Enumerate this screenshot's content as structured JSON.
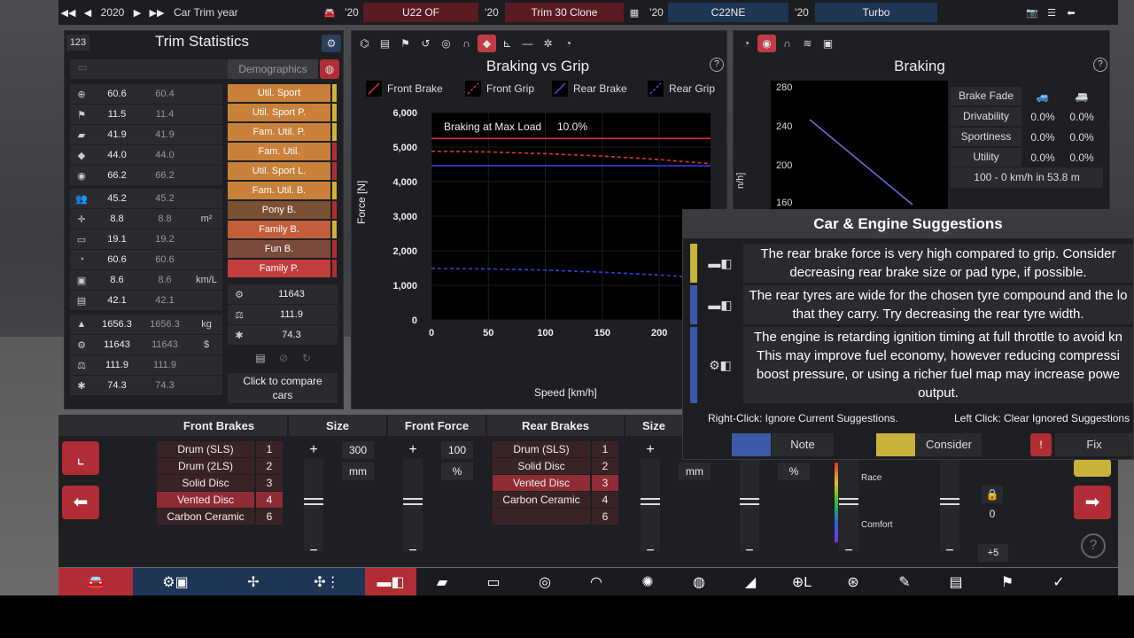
{
  "topbar": {
    "year": "2020",
    "label": "Car Trim year",
    "slots": [
      {
        "year": "'20",
        "name": "U22 OF",
        "color": "#5b1b23"
      },
      {
        "year": "'20",
        "name": "Trim 30 Clone",
        "color": "#5b1b23"
      },
      {
        "year": "'20",
        "name": "C22NE",
        "color": "#1f3555"
      },
      {
        "year": "'20",
        "name": "Turbo",
        "color": "#1f3555"
      }
    ]
  },
  "stats": {
    "badge": "123",
    "title": "Trim Statistics",
    "demographics_label": "Demographics",
    "rows": [
      {
        "icon": "steering-wheel-icon",
        "v1": "60.6",
        "v2": "60.4",
        "unit": ""
      },
      {
        "icon": "flag-icon",
        "v1": "11.5",
        "v2": "11.4",
        "unit": ""
      },
      {
        "icon": "seat-icon",
        "v1": "41.9",
        "v2": "41.9",
        "unit": ""
      },
      {
        "icon": "gem-icon",
        "v1": "44.0",
        "v2": "44.0",
        "unit": ""
      },
      {
        "icon": "ball-icon",
        "v1": "66.2",
        "v2": "66.2",
        "unit": ""
      },
      {
        "icon": "people-icon",
        "v1": "45.2",
        "v2": "45.2",
        "unit": ""
      },
      {
        "icon": "dimensions-icon",
        "v1": "8.8",
        "v2": "8.8",
        "unit": "m²"
      },
      {
        "icon": "car-icon",
        "v1": "19.1",
        "v2": "19.2",
        "unit": ""
      },
      {
        "icon": "gauge-icon",
        "v1": "60.6",
        "v2": "60.6",
        "unit": ""
      },
      {
        "icon": "fuel-icon",
        "v1": "8.6",
        "v2": "8.6",
        "unit": "km/L"
      },
      {
        "icon": "emissions-icon",
        "v1": "42.1",
        "v2": "42.1",
        "unit": ""
      },
      {
        "icon": "weight-icon",
        "v1": "1656.3",
        "v2": "1656.3",
        "unit": "kg"
      },
      {
        "icon": "cost-icon",
        "v1": "11643",
        "v2": "11643",
        "unit": "$"
      },
      {
        "icon": "service-icon",
        "v1": "111.9",
        "v2": "111.9",
        "unit": ""
      },
      {
        "icon": "production-icon",
        "v1": "74.3",
        "v2": "74.3",
        "unit": ""
      }
    ],
    "demographics": [
      {
        "label": "Util. Sport",
        "color": "#c9803a",
        "bar": "#d2b23b"
      },
      {
        "label": "Util. Sport P.",
        "color": "#c9803a",
        "bar": "#d2b23b"
      },
      {
        "label": "Fam. Util. P.",
        "color": "#c9803a",
        "bar": "#d2b23b"
      },
      {
        "label": "Fam. Util.",
        "color": "#c9803a",
        "bar": "#b02d35"
      },
      {
        "label": "Util. Sport L.",
        "color": "#c9803a",
        "bar": "#b02d35"
      },
      {
        "label": "Fam. Util. B.",
        "color": "#c9803a",
        "bar": "#d2b23b"
      },
      {
        "label": "Pony B.",
        "color": "#7a5032",
        "bar": "#b02d35"
      },
      {
        "label": "Family B.",
        "color": "#c35e3b",
        "bar": "#d2b23b"
      },
      {
        "label": "Fun B.",
        "color": "#7a4a3a",
        "bar": "#b02d35"
      },
      {
        "label": "Family P.",
        "color": "#c33e3e",
        "bar": "#b02d35"
      }
    ],
    "summary": [
      "11643",
      "111.9",
      "74.3"
    ],
    "compare_label": "Click to compare cars"
  },
  "chart_panel": {
    "title": "Braking vs Grip",
    "legend": [
      "Front Brake",
      "Front Grip",
      "Rear Brake",
      "Rear Grip"
    ],
    "annotation_label": "Braking at Max Load",
    "annotation_value": "10.0%",
    "xlabel": "Speed [km/h]",
    "ylabel": "Force [N]"
  },
  "chart_data": {
    "type": "line",
    "title": "Braking vs Grip",
    "xlabel": "Speed [km/h]",
    "ylabel": "Force [N]",
    "xlim": [
      0,
      245
    ],
    "ylim": [
      0,
      6000
    ],
    "xticks": [
      "0",
      "50",
      "100",
      "150",
      "200"
    ],
    "yticks": [
      "0",
      "1,000",
      "2,000",
      "3,000",
      "4,000",
      "5,000",
      "6,000"
    ],
    "x": [
      0,
      50,
      100,
      150,
      200,
      245
    ],
    "series": [
      {
        "name": "Front Brake",
        "color": "#e0303a",
        "dash": false,
        "values": [
          5250,
          5250,
          5250,
          5250,
          5250,
          5250
        ]
      },
      {
        "name": "Front Grip",
        "color": "#e0303a",
        "dash": true,
        "values": [
          4880,
          4860,
          4810,
          4740,
          4640,
          4520
        ]
      },
      {
        "name": "Rear Brake",
        "color": "#3a3ae0",
        "dash": false,
        "values": [
          4460,
          4460,
          4460,
          4460,
          4460,
          4460
        ]
      },
      {
        "name": "Rear Grip",
        "color": "#3a3ae0",
        "dash": true,
        "values": [
          1490,
          1475,
          1440,
          1380,
          1300,
          1200
        ]
      }
    ]
  },
  "braking_panel": {
    "title": "Braking",
    "yticks": [
      "280",
      "240",
      "200",
      "160"
    ],
    "ylabel_fragment": "n/h]",
    "brake_fade_label": "Brake Fade",
    "rows": [
      {
        "label": "Drivability",
        "a": "0.0%",
        "b": "0.0%"
      },
      {
        "label": "Sportiness",
        "a": "0.0%",
        "b": "0.0%"
      },
      {
        "label": "Utility",
        "a": "0.0%",
        "b": "0.0%"
      }
    ],
    "stopping": "100 - 0 km/h in 53.8 m"
  },
  "suggestions": {
    "title": "Car & Engine Suggestions",
    "items": [
      {
        "color": "#c9b23a",
        "icon": "rear-brake-icon",
        "text": "The rear brake force is very high compared to grip. Consider decreasing rear brake size or pad type, if possible."
      },
      {
        "color": "#3a5aa8",
        "icon": "rear-tyre-icon",
        "text": "The rear tyres are wide for the chosen tyre compound and the lo that they carry. Try decreasing the rear tyre width."
      },
      {
        "color": "#3a5aa8",
        "icon": "engine-icon",
        "text": "The engine is retarding ignition timing at full throttle to avoid kn This may improve fuel economy, however reducing compressi boost pressure, or using a richer fuel map may increase powe output."
      }
    ],
    "hint_right": "Right-Click: Ignore Current Suggestions.",
    "hint_left": "Left Click: Clear Ignored Suggestions",
    "note_label": "Note",
    "consider_label": "Consider",
    "fix_label": "Fix"
  },
  "bottom": {
    "front_brakes": {
      "header": "Front Brakes",
      "options": [
        {
          "label": "Drum (SLS)",
          "num": "1",
          "selected": false
        },
        {
          "label": "Drum (2LS)",
          "num": "2",
          "selected": false
        },
        {
          "label": "Solid Disc",
          "num": "3",
          "selected": false
        },
        {
          "label": "Vented Disc",
          "num": "4",
          "selected": true
        },
        {
          "label": "Carbon Ceramic",
          "num": "6",
          "selected": false
        }
      ]
    },
    "size_header": "Size",
    "front_size": {
      "value": "300",
      "unit": "mm"
    },
    "front_force_header": "Front Force",
    "front_force": {
      "value": "100",
      "unit": "%"
    },
    "rear_brakes": {
      "header": "Rear Brakes",
      "options": [
        {
          "label": "Drum (SLS)",
          "num": "1",
          "selected": false
        },
        {
          "label": "Solid Disc",
          "num": "2",
          "selected": false
        },
        {
          "label": "Vented Disc",
          "num": "3",
          "selected": true
        },
        {
          "label": "Carbon Ceramic",
          "num": "4",
          "selected": false
        },
        {
          "label": "",
          "num": "6",
          "selected": false
        }
      ]
    },
    "rear_size_header": "Size",
    "rear_size_unit": "mm",
    "rear_pct_unit": "%",
    "race_label": "Race",
    "comfort_label": "Comfort",
    "lock_value": "0",
    "plus_five": "+5"
  }
}
